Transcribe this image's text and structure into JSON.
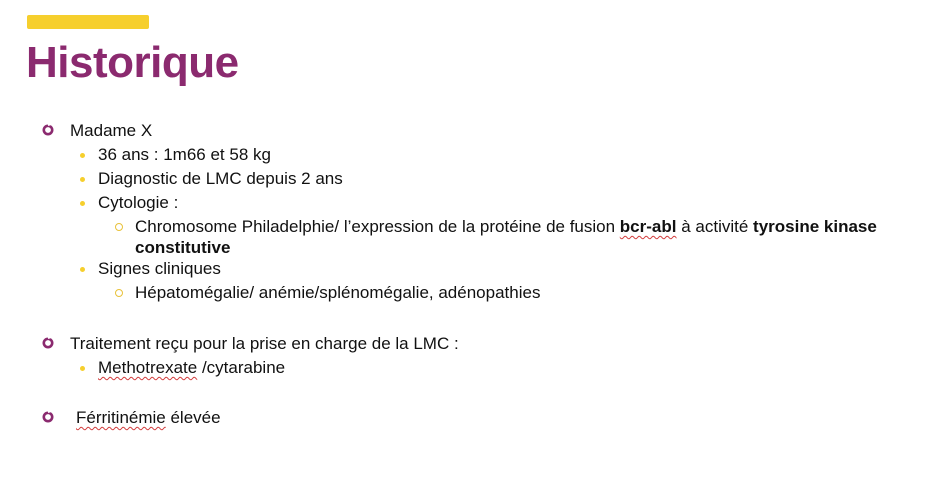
{
  "slide": {
    "title": "Historique",
    "colors": {
      "title": "#8b2a6f",
      "accent": "#f6cf2d",
      "bullet": "#8b2a6f"
    },
    "items": {
      "patient": "Madame X",
      "age_weight": "36 ans : 1m66 et 58 kg",
      "diagnosis": "Diagnostic de LMC depuis 2 ans",
      "cytology_label": "Cytologie :",
      "cytology_detail_1": "Chromosome Philadelphie/ l’expression de la protéine de fusion ",
      "cytology_bold_1": "bcr-abl",
      "cytology_detail_2": " à activité ",
      "cytology_bold_2": "tyrosine kinase constitutive",
      "clinical_label": "Signes cliniques",
      "clinical_detail": "Hépatomégalie/ anémie/splénomégalie, adénopathies",
      "treatment_label": "Traitement reçu pour la prise en charge de la LMC :",
      "treatment_drug": "Methotrexate",
      "treatment_drug_rest": " /cytarabine",
      "ferritin_word": "Férritinémie",
      "ferritin_rest": " élevée"
    }
  }
}
